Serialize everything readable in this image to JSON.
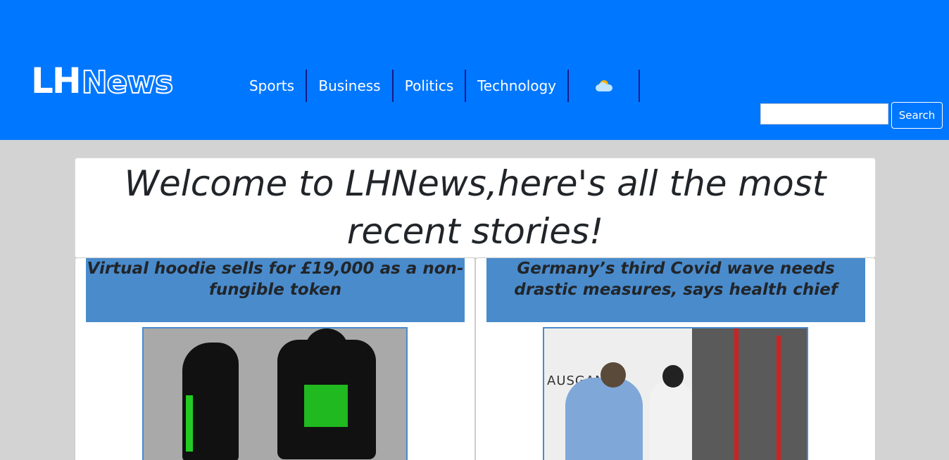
{
  "brand": {
    "logo_part1": "LH",
    "logo_part2": "News"
  },
  "nav": {
    "items": [
      {
        "label": "Sports"
      },
      {
        "label": "Business"
      },
      {
        "label": "Politics"
      },
      {
        "label": "Technology"
      }
    ],
    "weather_icon": "partly-cloudy-icon"
  },
  "search": {
    "value": "",
    "button_label": "Search"
  },
  "welcome": {
    "heading": "Welcome to LHNews,here's all the most recent stories!"
  },
  "stories": [
    {
      "headline": "Virtual hoodie sells for £19,000 as a non-fungible token"
    },
    {
      "headline": "Germany’s third Covid wave needs drastic measures, says health chief"
    }
  ],
  "image_text": {
    "bus_sign": "AUSGANG"
  },
  "colors": {
    "header_bg": "#0077ff",
    "card_header_bg": "#4a8bcc",
    "page_bg": "#d3d3d3"
  }
}
